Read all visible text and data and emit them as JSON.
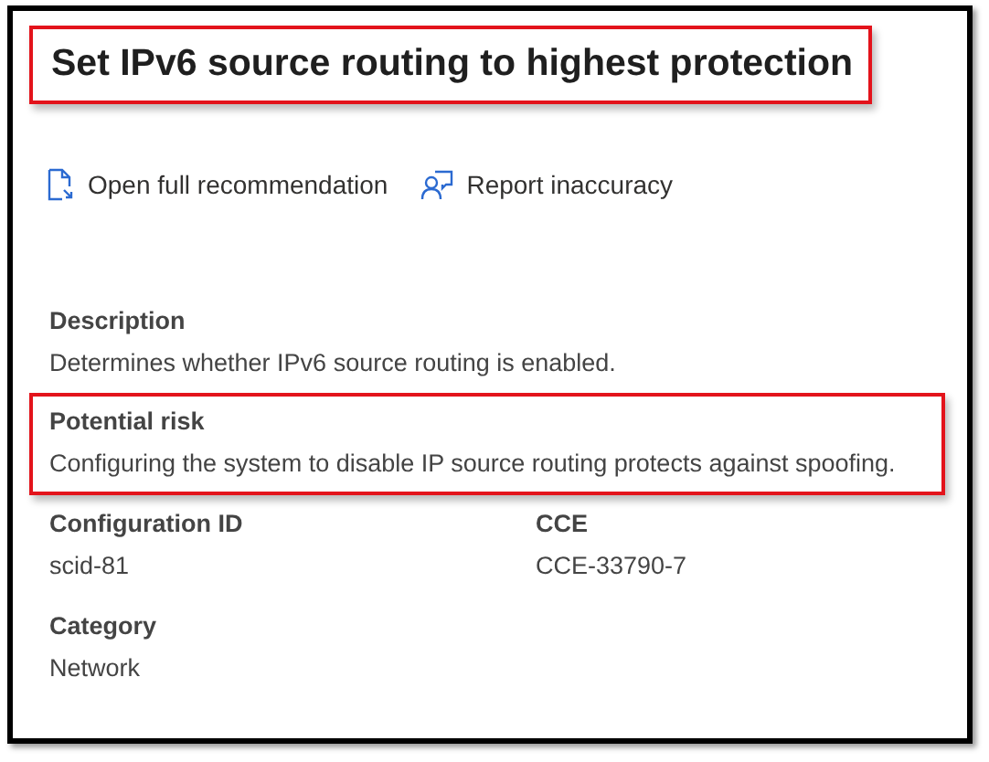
{
  "title": {
    "text": "Set IPv6 source routing to highest protection",
    "highlighted": true
  },
  "actions": [
    {
      "kind": "document",
      "label": "Open full recommendation"
    },
    {
      "kind": "report",
      "label": "Report inaccuracy"
    }
  ],
  "fields": [
    {
      "label": "Description",
      "value": "Determines whether IPv6 source routing is enabled.",
      "highlighted": false
    },
    {
      "label": "Potential risk",
      "value": "Configuring the system to disable IP source routing protects against spoofing.",
      "highlighted": true
    }
  ],
  "details": [
    {
      "label": "Configuration ID",
      "value": "scid-81"
    },
    {
      "label": "CCE",
      "value": "CCE-33790-7"
    },
    {
      "label": "Category",
      "value": "Network"
    }
  ]
}
